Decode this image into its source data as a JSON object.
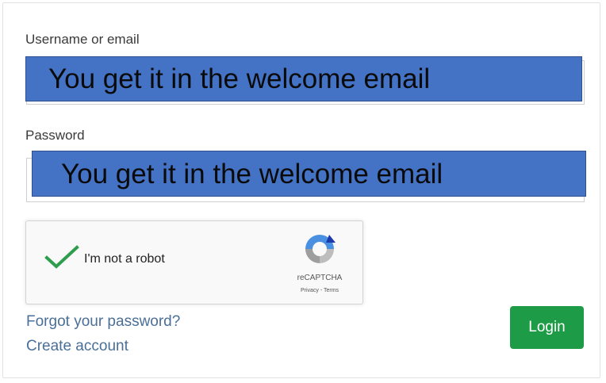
{
  "form": {
    "username_label": "Username or email",
    "password_label": "Password",
    "username_value": "",
    "password_value": ""
  },
  "overlay": {
    "username_note": "You get it in the welcome email",
    "password_note": "You get it in the welcome email",
    "fill_color": "#4472c4"
  },
  "captcha": {
    "label": "I'm not a robot",
    "brand": "reCAPTCHA",
    "links": "Privacy - Terms",
    "checked": true,
    "check_color": "#2e9e4e",
    "icon": "recaptcha-logo-icon"
  },
  "links": {
    "forgot": "Forgot your password?",
    "create": "Create account"
  },
  "actions": {
    "login_label": "Login",
    "login_color": "#1e9b46"
  }
}
